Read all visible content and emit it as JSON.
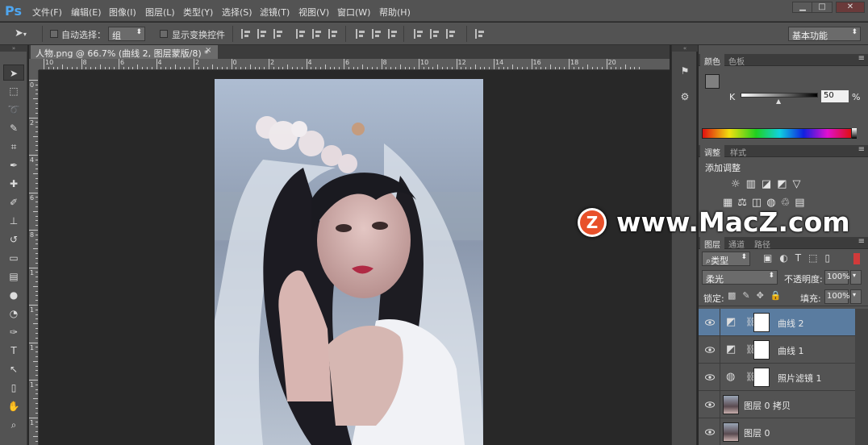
{
  "app": {
    "logo": "Ps",
    "brand_color": "#4ea6f0"
  },
  "menu": [
    "文件(F)",
    "编辑(E)",
    "图像(I)",
    "图层(L)",
    "类型(Y)",
    "选择(S)",
    "滤镜(T)",
    "视图(V)",
    "窗口(W)",
    "帮助(H)"
  ],
  "window_controls": [
    "▁",
    "□",
    "✕"
  ],
  "options": {
    "auto_select_label": "自动选择：",
    "auto_select_value": "组",
    "show_transform_label": "显示变换控件",
    "workspace": "基本功能"
  },
  "document": {
    "tab_title": "人物.png @ 66.7% (曲线 2, 图层蒙版/8) *",
    "close": "×"
  },
  "ruler": {
    "h_labels": [
      "10",
      "8",
      "6",
      "4",
      "2",
      "0",
      "2",
      "4",
      "6",
      "8",
      "10",
      "12",
      "14",
      "16",
      "18",
      "20"
    ],
    "v_labels": [
      "0",
      "2",
      "4",
      "6",
      "8",
      "1",
      "1",
      "1",
      "1",
      "1"
    ]
  },
  "tools": [
    "move-tool",
    "marquee-tool",
    "lasso-tool",
    "quick-select-tool",
    "crop-tool",
    "eyedropper-tool",
    "healing-tool",
    "brush-tool",
    "stamp-tool",
    "history-brush-tool",
    "eraser-tool",
    "gradient-tool",
    "blur-tool",
    "dodge-tool",
    "pen-tool",
    "type-tool",
    "path-select-tool",
    "shape-tool",
    "hand-tool",
    "zoom-tool"
  ],
  "color_panel": {
    "tabs": [
      "颜色",
      "色板"
    ],
    "channel": "K",
    "value": "50",
    "unit": "%",
    "swatch_color": "#808080"
  },
  "adjust_panel": {
    "tabs": [
      "调整",
      "样式"
    ],
    "title": "添加调整"
  },
  "layers_panel": {
    "tabs": [
      "图层",
      "通道",
      "路径"
    ],
    "filter_label": "类型",
    "blend_mode": "柔光",
    "opacity_label": "不透明度:",
    "opacity": "100%",
    "lock_label": "锁定:",
    "fill_label": "填充:",
    "fill": "100%",
    "layers": [
      {
        "name": "曲线 2",
        "type": "adjust",
        "selected": true
      },
      {
        "name": "曲线 1",
        "type": "adjust",
        "selected": false
      },
      {
        "name": "照片滤镜 1",
        "type": "filter",
        "selected": false
      },
      {
        "name": "图层 0 拷贝",
        "type": "image",
        "selected": false
      },
      {
        "name": "图层 0",
        "type": "image",
        "selected": false
      }
    ]
  },
  "watermark": {
    "logo_letter": "Z",
    "text": "www.MacZ.com",
    "logo_color": "#e8502a"
  }
}
